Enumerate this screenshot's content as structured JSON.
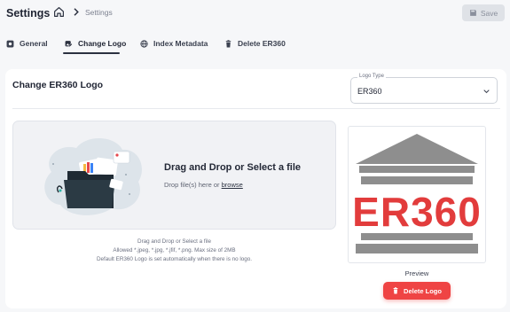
{
  "header": {
    "title": "Settings",
    "breadcrumb": "Settings",
    "save_label": "Save",
    "home_icon": "home-icon",
    "save_icon": "save-icon"
  },
  "tabs": [
    {
      "label": "General",
      "icon": "gear-icon",
      "active": false
    },
    {
      "label": "Change Logo",
      "icon": "edit-image-icon",
      "active": true
    },
    {
      "label": "Index Metadata",
      "icon": "globe-icon",
      "active": false
    },
    {
      "label": "Delete ER360",
      "icon": "trash-icon",
      "active": false
    }
  ],
  "card": {
    "title": "Change ER360 Logo",
    "logo_type": {
      "legend": "Logo Type",
      "value": "ER360"
    },
    "dropzone": {
      "title": "Drag and Drop or Select a file",
      "subtitle_prefix": "Drop file(s) here or",
      "browse_link": "browse"
    },
    "help": [
      "Drag and Drop or Select a file",
      "Allowed *.jpeg, *.jpg, *.jfif, *.png. Max size of 2MB",
      "Default ER360 Logo is set automatically when there is no logo."
    ],
    "preview": {
      "label": "Preview",
      "logo_text": "ER360"
    },
    "delete_label": "Delete Logo"
  },
  "colors": {
    "accent": "#2b3140",
    "danger": "#ef4444",
    "logo_gray": "#8e8e8e",
    "logo_red": "#e23c3c"
  }
}
